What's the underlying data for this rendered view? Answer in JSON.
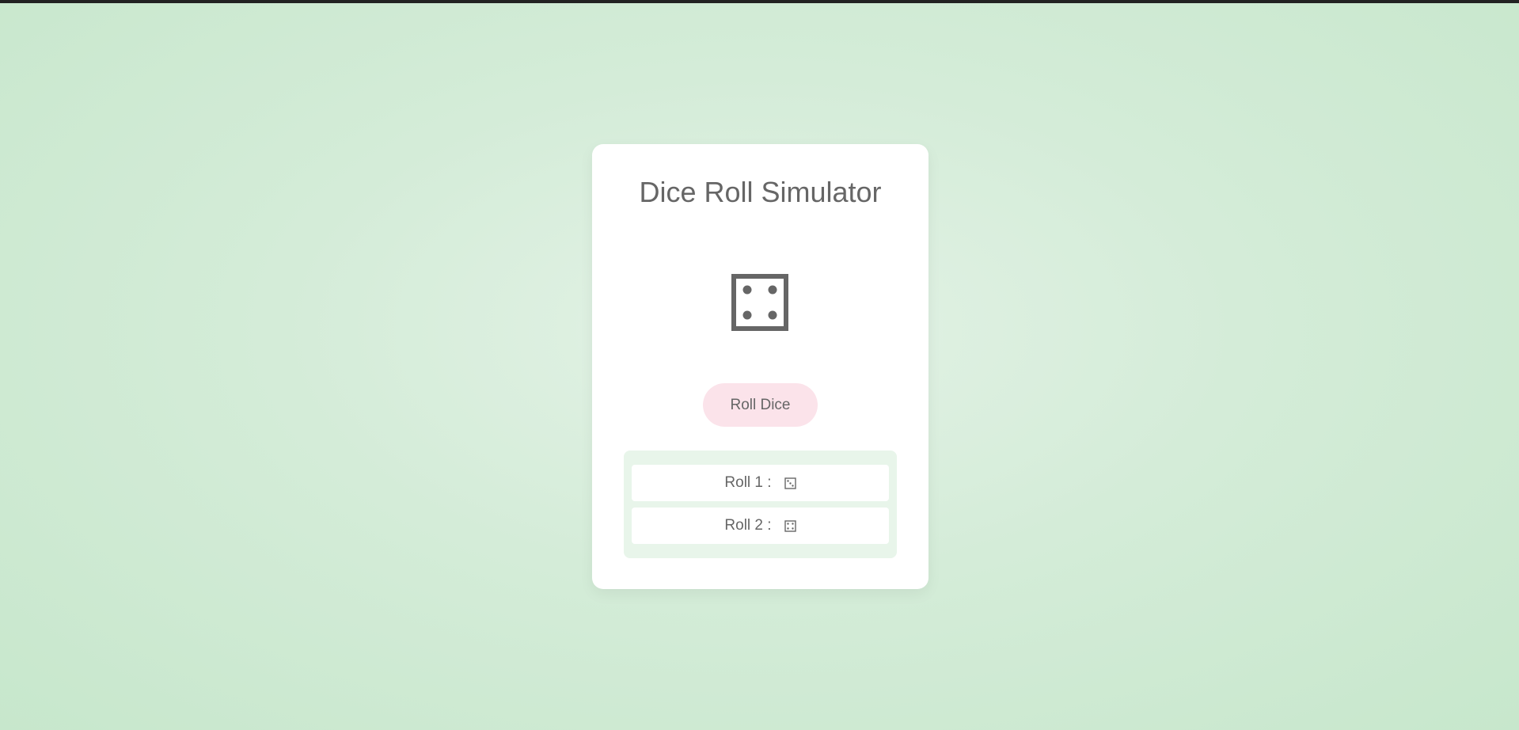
{
  "app": {
    "title": "Dice Roll Simulator"
  },
  "current_die": {
    "value": 4,
    "icon": "die-four-icon"
  },
  "actions": {
    "roll_label": "Roll Dice"
  },
  "history": [
    {
      "label": "Roll 1 :",
      "value": 3,
      "icon": "die-three-icon"
    },
    {
      "label": "Roll 2 :",
      "value": 4,
      "icon": "die-four-icon"
    }
  ],
  "colors": {
    "background": "#d4ecd8",
    "card": "#ffffff",
    "button": "#fbe3ea",
    "history_bg": "#e8f5ea",
    "text": "#666666"
  }
}
